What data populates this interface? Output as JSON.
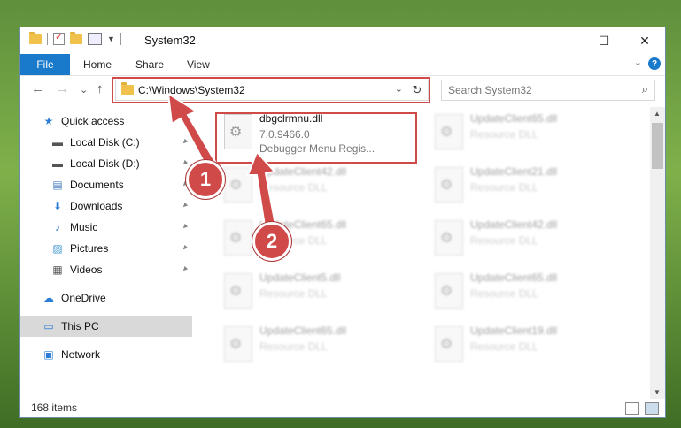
{
  "window": {
    "title": "System32",
    "minimize": "—",
    "maximize": "☐",
    "close": "✕"
  },
  "ribbon": {
    "tabs": [
      "File",
      "Home",
      "Share",
      "View"
    ],
    "help": "?",
    "expand": "⌄"
  },
  "navigation": {
    "back": "←",
    "forward": "→",
    "recent": "⌄",
    "up": "↑",
    "address": "C:\\Windows\\System32",
    "address_dropdown": "⌄",
    "refresh": "↻",
    "search_placeholder": "Search System32",
    "search_icon": "⌕"
  },
  "sidebar": {
    "items": [
      {
        "label": "Quick access",
        "icon": "star-icon",
        "glyph": "★",
        "color": "#2a7dd6",
        "pinned": false
      },
      {
        "label": "Local Disk (C:)",
        "icon": "drive-icon",
        "glyph": "▬",
        "color": "#555555",
        "pinned": true
      },
      {
        "label": "Local Disk (D:)",
        "icon": "drive-icon",
        "glyph": "▬",
        "color": "#555555",
        "pinned": true
      },
      {
        "label": "Documents",
        "icon": "documents-icon",
        "glyph": "▤",
        "color": "#4a7fbf",
        "pinned": true
      },
      {
        "label": "Downloads",
        "icon": "download-icon",
        "glyph": "⬇",
        "color": "#2a7dd6",
        "pinned": true
      },
      {
        "label": "Music",
        "icon": "music-icon",
        "glyph": "♪",
        "color": "#2a7dd6",
        "pinned": true
      },
      {
        "label": "Pictures",
        "icon": "pictures-icon",
        "glyph": "▨",
        "color": "#4a9fd6",
        "pinned": true
      },
      {
        "label": "Videos",
        "icon": "videos-icon",
        "glyph": "▦",
        "color": "#555555",
        "pinned": true
      },
      {
        "label": "OneDrive",
        "icon": "cloud-icon",
        "glyph": "☁",
        "color": "#2a7dd6",
        "pinned": false
      },
      {
        "label": "This PC",
        "icon": "monitor-icon",
        "glyph": "▭",
        "color": "#2a7dd6",
        "pinned": false
      },
      {
        "label": "Network",
        "icon": "network-icon",
        "glyph": "▣",
        "color": "#2a7dd6",
        "pinned": false
      }
    ],
    "pin_glyph": "📌"
  },
  "files": {
    "selected": {
      "name": "dbgclrmnu.dll",
      "version": "7.0.9466.0",
      "description": "Debugger Menu Regis..."
    },
    "others": [
      {
        "name": "UpdateClient65.dll",
        "type": "Resource DLL"
      },
      {
        "name": "UpdateClient42.dll",
        "type": "Resource DLL"
      },
      {
        "name": "UpdateClient21.dll",
        "type": "Resource DLL"
      },
      {
        "name": "UpdateClient65.dll",
        "type": "Resource DLL"
      },
      {
        "name": "UpdateClient42.dll",
        "type": "Resource DLL"
      },
      {
        "name": "UpdateClient5.dll",
        "type": "Resource DLL"
      },
      {
        "name": "UpdateClient65.dll",
        "type": "Resource DLL"
      },
      {
        "name": "UpdateClient65.dll",
        "type": "Resource DLL"
      },
      {
        "name": "UpdateClient19.dll",
        "type": "Resource DLL"
      }
    ]
  },
  "status": {
    "item_count": "168 items"
  },
  "callouts": {
    "one": "1",
    "two": "2",
    "color": "#d04a4a"
  }
}
